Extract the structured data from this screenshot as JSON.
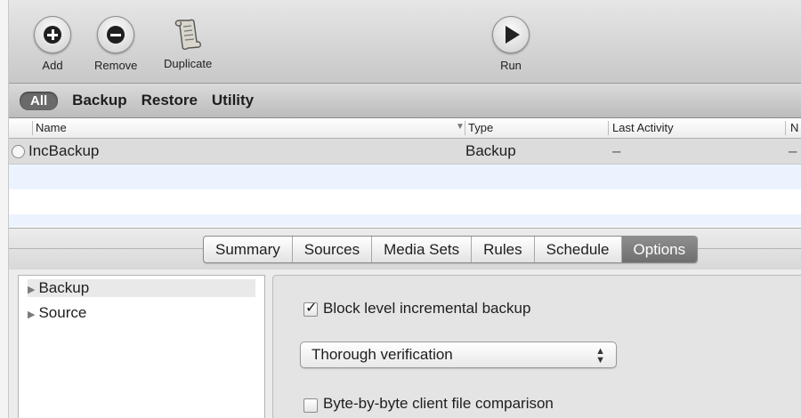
{
  "toolbar": {
    "buttons": [
      {
        "label": "Add",
        "icon": "plus-icon"
      },
      {
        "label": "Remove",
        "icon": "minus-icon"
      },
      {
        "label": "Duplicate",
        "icon": "scroll-icon"
      },
      {
        "label": "Run",
        "icon": "play-icon"
      }
    ]
  },
  "scope": {
    "items": [
      "All",
      "Backup",
      "Restore",
      "Utility"
    ],
    "selected": "All"
  },
  "table": {
    "columns": [
      "Name",
      "Type",
      "Last Activity",
      "N"
    ],
    "rows": [
      {
        "name": "IncBackup",
        "type": "Backup",
        "last_activity": "–",
        "next": "–"
      }
    ]
  },
  "tabs": {
    "items": [
      "Summary",
      "Sources",
      "Media Sets",
      "Rules",
      "Schedule",
      "Options"
    ],
    "active": "Options"
  },
  "sidebar": {
    "items": [
      {
        "label": "Backup",
        "selected": true
      },
      {
        "label": "Source",
        "selected": false
      }
    ]
  },
  "options": {
    "block_level": {
      "label": "Block level incremental backup",
      "checked": true
    },
    "verification": {
      "value": "Thorough verification"
    },
    "byte_compare": {
      "label": "Byte-by-byte client file comparison",
      "checked": false
    }
  }
}
